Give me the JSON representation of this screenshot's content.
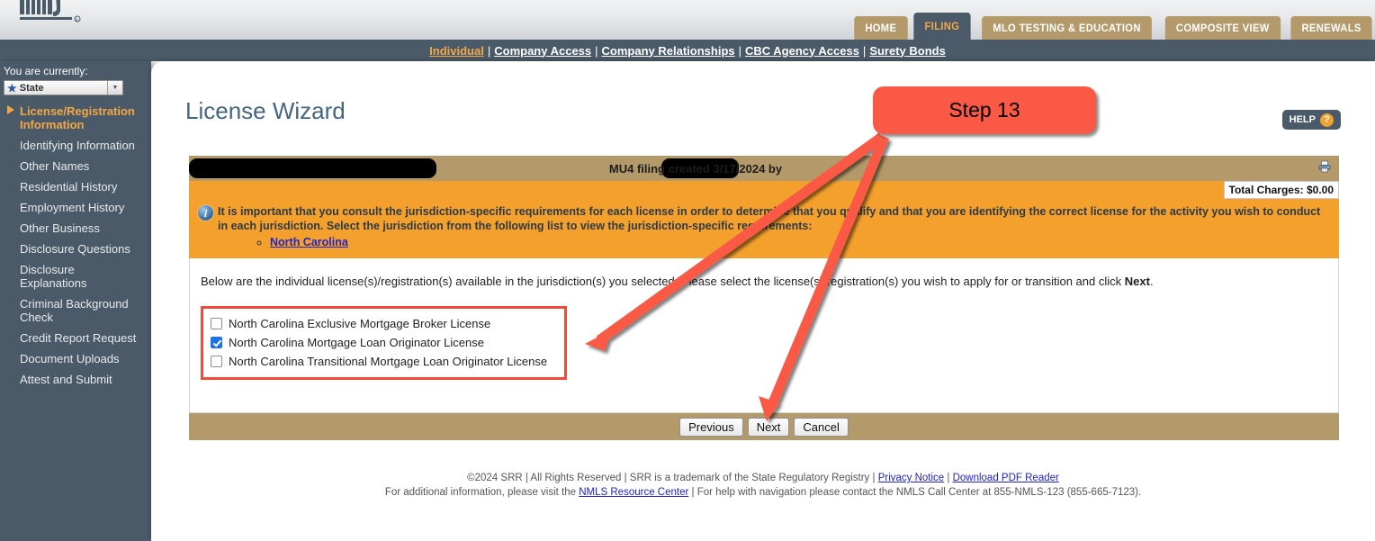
{
  "header": {
    "logo_alt": "NMLS",
    "tabs": [
      {
        "label": "HOME",
        "active": false
      },
      {
        "label": "FILING",
        "active": true
      },
      {
        "label": "MLO TESTING & EDUCATION",
        "active": false
      },
      {
        "label": "COMPOSITE VIEW",
        "active": false
      },
      {
        "label": "RENEWALS",
        "active": false
      }
    ]
  },
  "subnav": {
    "items": [
      "Individual",
      "Company Access",
      "Company Relationships",
      "CBC Agency Access",
      "Surety Bonds"
    ],
    "selected": "Individual",
    "separator": "|"
  },
  "sidebar": {
    "you_are_currently_label": "You are currently:",
    "context_value": "State",
    "items": [
      {
        "label": "License/Registration Information",
        "active": true
      },
      {
        "label": "Identifying Information",
        "active": false
      },
      {
        "label": "Other Names",
        "active": false
      },
      {
        "label": "Residential History",
        "active": false
      },
      {
        "label": "Employment History",
        "active": false
      },
      {
        "label": "Other Business",
        "active": false
      },
      {
        "label": "Disclosure Questions",
        "active": false
      },
      {
        "label": "Disclosure Explanations",
        "active": false
      },
      {
        "label": "Criminal Background Check",
        "active": false
      },
      {
        "label": "Credit Report Request",
        "active": false
      },
      {
        "label": "Document Uploads",
        "active": false
      },
      {
        "label": "Attest and Submit",
        "active": false
      }
    ]
  },
  "main": {
    "page_title": "License Wizard",
    "help_label": "HELP",
    "help_qmark": "?",
    "filing_bar_text": "MU4 filing created 3/17/2024 by",
    "total_charges": "Total Charges: $0.00",
    "info": {
      "text": "It is important that you consult the jurisdiction-specific requirements for each license in order to determine that you qualify and that you are identifying the correct license for the activity you wish to conduct in each jurisdiction. Select the jurisdiction from the following list to view the jurisdiction-specific requirements:",
      "links": [
        "North Carolina"
      ]
    },
    "instructions_part1": "Below are the individual license(s)/registration(s) available in the jurisdiction(s) you selected. Please select the license(s)/registration(s) you wish to apply for or transition and click ",
    "instructions_bold": "Next",
    "instructions_part2": ".",
    "licenses": [
      {
        "label": "North Carolina Exclusive Mortgage Broker License",
        "checked": false
      },
      {
        "label": "North Carolina Mortgage Loan Originator License",
        "checked": true
      },
      {
        "label": "North Carolina Transitional Mortgage Loan Originator License",
        "checked": false
      }
    ],
    "buttons": [
      {
        "label": "Previous"
      },
      {
        "label": "Next"
      },
      {
        "label": "Cancel"
      }
    ]
  },
  "footer": {
    "line1_a": "©2024 SRR | All Rights Reserved | SRR is a trademark of the State Regulatory Registry | ",
    "line1_link1": "Privacy Notice",
    "line1_b": " | ",
    "line1_link2": "Download PDF Reader",
    "line2_a": "For additional information, please visit the ",
    "line2_link1": "NMLS Resource Center",
    "line2_b": " | For help with navigation please contact the NMLS Call Center at 855-NMLS-123 (855-665-7123)."
  },
  "annotation": {
    "callout_label": "Step 13",
    "callout_color": "#fa5a45",
    "highlight_color": "#ef4a3a"
  }
}
